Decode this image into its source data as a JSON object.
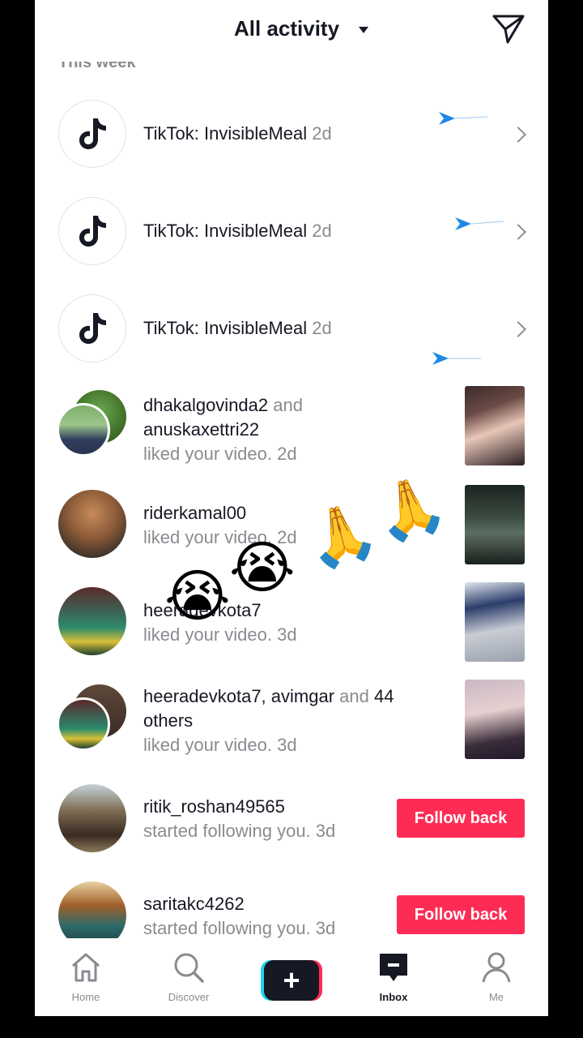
{
  "header": {
    "title": "All activity"
  },
  "section": {
    "label": "This week"
  },
  "tiktok_rows": [
    {
      "name": "TikTok:",
      "message": "InvisibleMeal",
      "time": "2d"
    },
    {
      "name": "TikTok:",
      "message": "InvisibleMeal",
      "time": "2d"
    },
    {
      "name": "TikTok:",
      "message": "InvisibleMeal",
      "time": "2d"
    }
  ],
  "like_rows": [
    {
      "users": "dhakalgovinda2",
      "joiner": "and",
      "users2": "anuskaxettri22",
      "action": "liked your video.",
      "time": "2d"
    },
    {
      "users": "riderkamal00",
      "action": "liked your video.",
      "time": "2d"
    },
    {
      "users": "heeradevkota7",
      "action": "liked your video.",
      "time": "3d"
    },
    {
      "users": "heeradevkota7, avimgar",
      "joiner": "and",
      "count": "44",
      "others": "others",
      "action": "liked your video.",
      "time": "3d"
    }
  ],
  "follow_rows": [
    {
      "user": "ritik_roshan49565",
      "action": "started following you.",
      "time": "3d",
      "button": "Follow back"
    },
    {
      "user": "saritakc4262",
      "action": "started following you.",
      "time": "3d",
      "button": "Follow back"
    }
  ],
  "overlay": {
    "crying": "😭",
    "pray": "🙏"
  },
  "tabs": [
    {
      "label": "Home",
      "icon": "home-icon"
    },
    {
      "label": "Discover",
      "icon": "search-icon"
    },
    {
      "label": "",
      "icon": "plus-icon"
    },
    {
      "label": "Inbox",
      "icon": "inbox-icon"
    },
    {
      "label": "Me",
      "icon": "profile-icon"
    }
  ],
  "colors": {
    "accent": "#fe2c55",
    "text": "#161823",
    "muted": "#8a8b91",
    "plane": "#1e88e5"
  }
}
